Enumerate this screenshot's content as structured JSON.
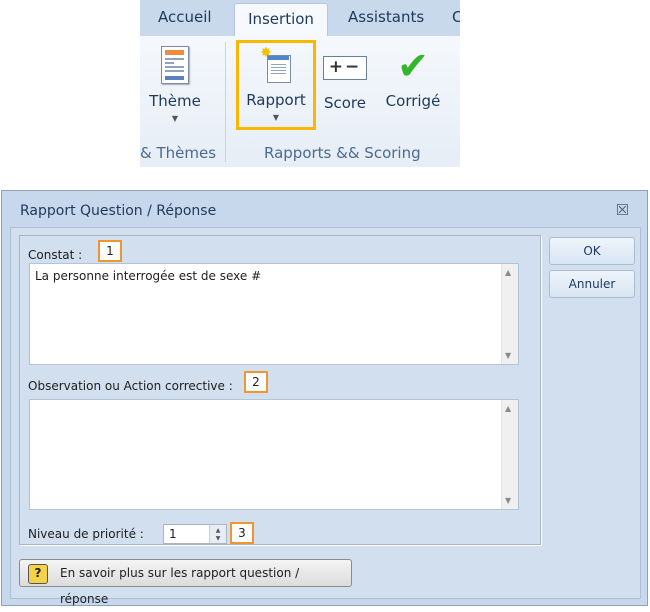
{
  "ribbon": {
    "tabs": [
      {
        "label": "Accueil",
        "active": false
      },
      {
        "label": "Insertion",
        "active": true
      },
      {
        "label": "Assistants",
        "active": false
      },
      {
        "label": "C",
        "active": false
      }
    ],
    "buttons": {
      "theme": {
        "label": "Thème",
        "icon": "theme-document-icon",
        "dropdown": true
      },
      "rapport": {
        "label": "Rapport",
        "icon": "report-new-icon",
        "dropdown": true,
        "highlighted": true
      },
      "score": {
        "label": "Score",
        "icon": "plus-minus-icon",
        "glyph": "+−"
      },
      "corrige": {
        "label": "Corrigé",
        "icon": "checkmark-icon",
        "glyph": "✔"
      }
    },
    "groups": [
      "& Thèmes",
      "Rapports && Scoring"
    ],
    "highlight_color": "#f9b800"
  },
  "dialog": {
    "title": "Rapport Question / Réponse",
    "close_glyph": "☒",
    "constat": {
      "label": "Constat :",
      "badge": "1",
      "value": "La personne interrogée est de sexe #"
    },
    "observation": {
      "label": "Observation ou Action corrective :",
      "badge": "2",
      "value": ""
    },
    "priority": {
      "label": "Niveau de priorité :",
      "value": "1",
      "badge": "3"
    },
    "ok_label": "OK",
    "cancel_label": "Annuler",
    "help_label": "En savoir plus sur les rapport question / réponse",
    "badge_color": "#f0952f"
  }
}
